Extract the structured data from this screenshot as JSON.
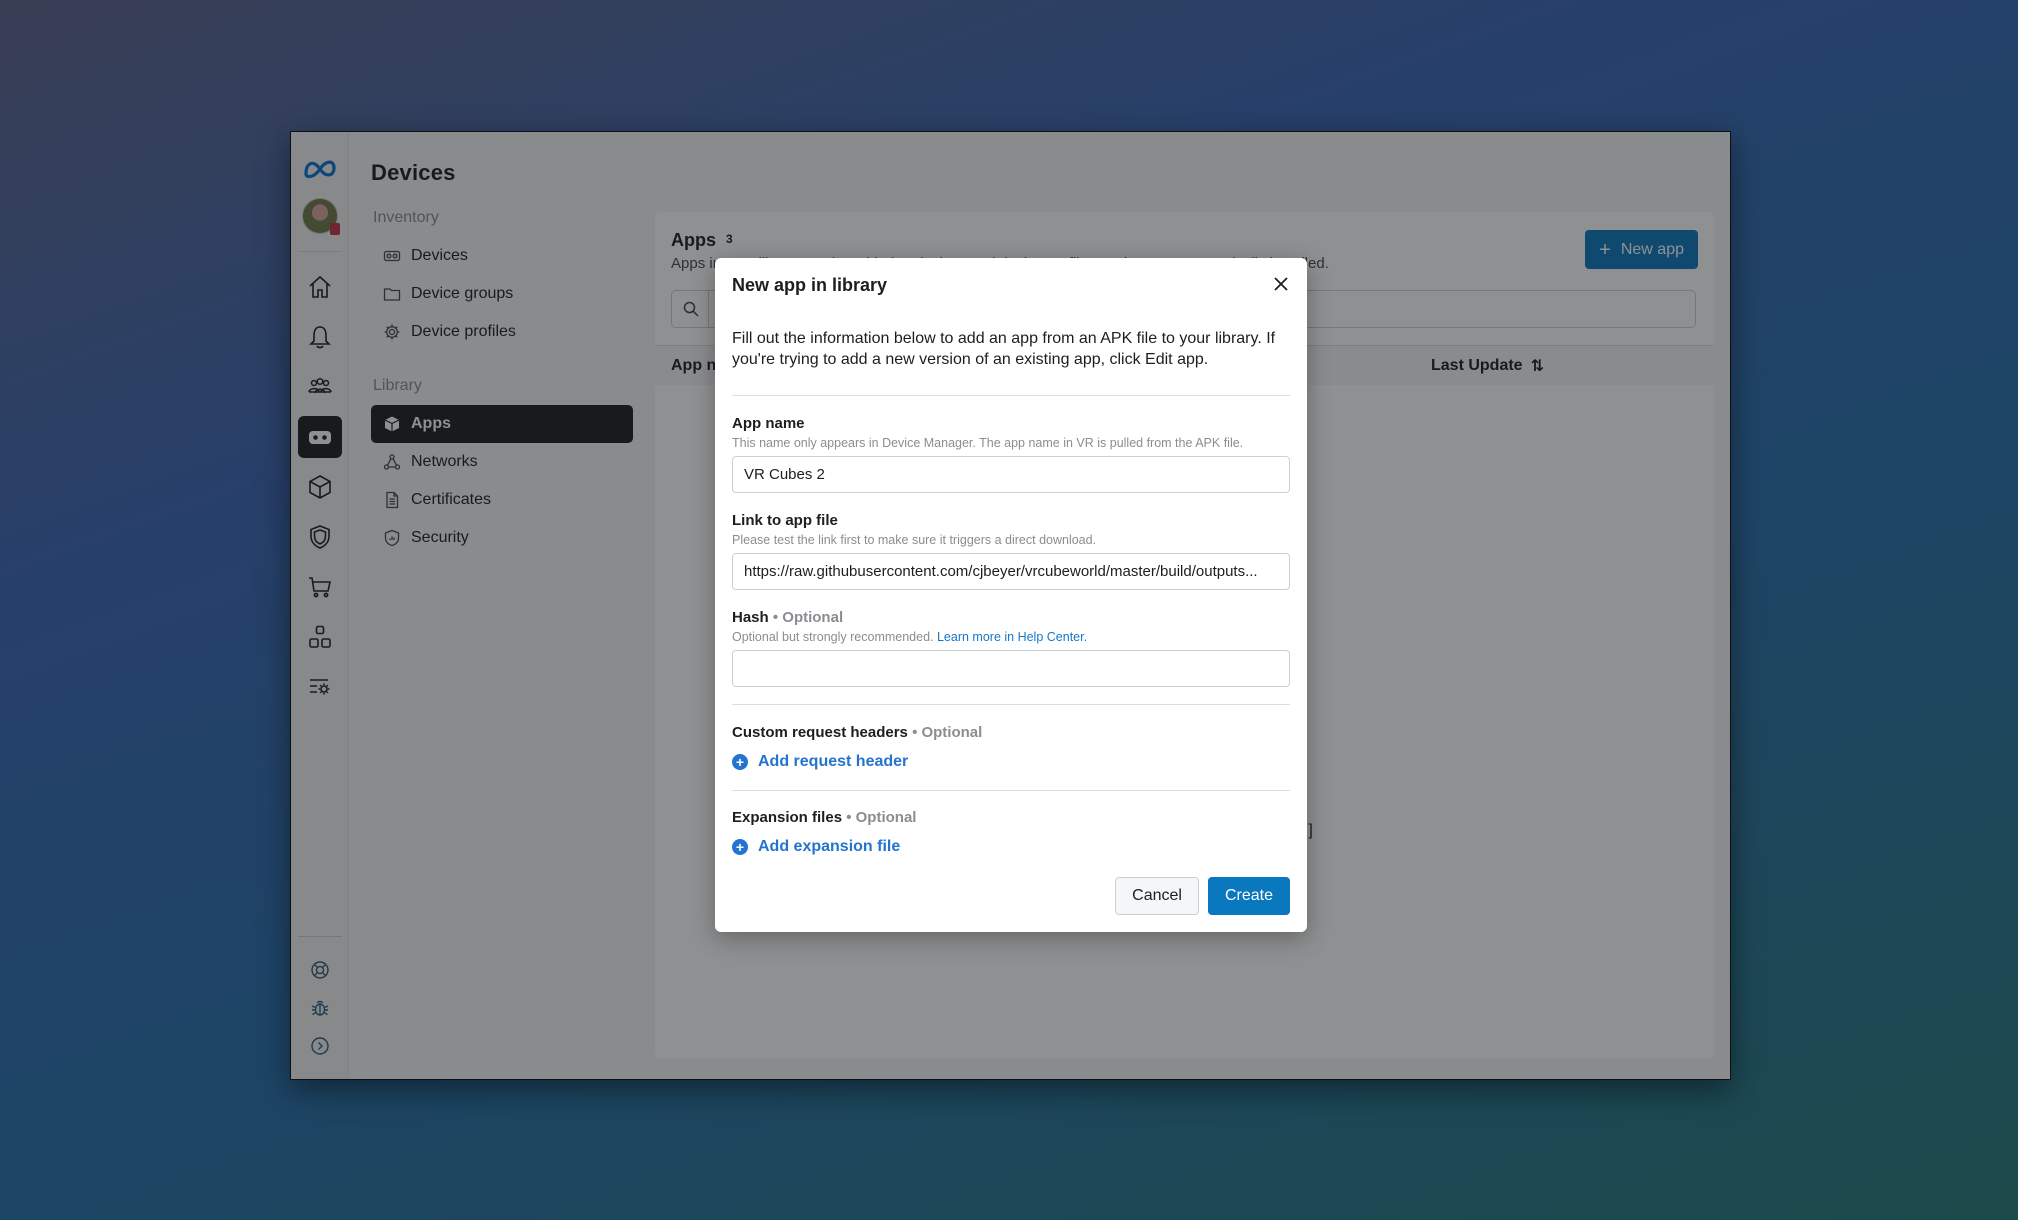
{
  "colors": {
    "accent": "#0a78be",
    "link": "#2374d0",
    "dark": "#1c1e21"
  },
  "rail": {
    "logo": "meta-logo-icon",
    "items": [
      {
        "icon": "home-icon"
      },
      {
        "icon": "bell-icon"
      },
      {
        "icon": "people-icon"
      },
      {
        "icon": "vr-headset-icon",
        "active": true
      },
      {
        "icon": "cube-icon"
      },
      {
        "icon": "shield-icon"
      },
      {
        "icon": "cart-icon"
      },
      {
        "icon": "apps-grid-icon"
      },
      {
        "icon": "settings-list-icon"
      }
    ],
    "bottom": [
      "lifebuoy-icon",
      "bug-icon",
      "expand-icon"
    ]
  },
  "nav": {
    "title": "Devices",
    "inventory_label": "Inventory",
    "inventory": [
      {
        "label": "Devices",
        "icon": "headset-icon"
      },
      {
        "label": "Device groups",
        "icon": "folder-icon"
      },
      {
        "label": "Device profiles",
        "icon": "gear-icon"
      }
    ],
    "library_label": "Library",
    "library": [
      {
        "label": "Apps",
        "icon": "box-icon",
        "active": true
      },
      {
        "label": "Networks",
        "icon": "network-icon"
      },
      {
        "label": "Certificates",
        "icon": "document-icon"
      },
      {
        "label": "Security",
        "icon": "shield-chart-icon"
      }
    ]
  },
  "apps_page": {
    "title": "Apps",
    "count": "3",
    "description": "Apps in your library can be added to devices and device profiles so they are automatically installed.",
    "new_app_label": "New app",
    "columns": [
      "App name",
      "Last Update"
    ],
    "obscured_fragment": "e.]"
  },
  "modal": {
    "title": "New app in library",
    "intro": "Fill out the information below to add an app from an APK file to your library. If you're trying to add a new version of an existing app, click Edit app.",
    "app_name": {
      "label": "App name",
      "help": "This name only appears in Device Manager. The app name in VR is pulled from the APK file.",
      "value": "VR Cubes 2"
    },
    "link": {
      "label": "Link to app file",
      "help": "Please test the link first to make sure it triggers a direct download.",
      "value": "https://raw.githubusercontent.com/cjbeyer/vrcubeworld/master/build/outputs..."
    },
    "hash": {
      "label": "Hash",
      "optional": "• Optional",
      "help": "Optional but strongly recommended.",
      "help_link": "Learn more in Help Center.",
      "value": ""
    },
    "headers": {
      "label": "Custom request headers",
      "optional": "• Optional",
      "add_label": "Add request header"
    },
    "expansion": {
      "label": "Expansion files",
      "optional": "• Optional",
      "add_label": "Add expansion file"
    },
    "cancel_label": "Cancel",
    "create_label": "Create"
  }
}
